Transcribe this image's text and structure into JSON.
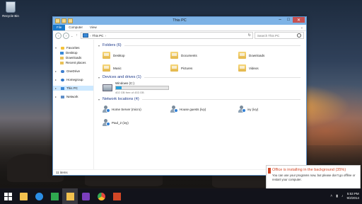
{
  "desktop": {
    "icons": [
      {
        "label": "Recycle Bin",
        "icon": "recycle-bin-icon"
      }
    ]
  },
  "window": {
    "title": "This PC",
    "ribbon_tabs": [
      "File",
      "Computer",
      "View"
    ],
    "address": {
      "path": [
        "This PC"
      ]
    },
    "search": {
      "placeholder": "Search This PC"
    },
    "nav_pane": [
      {
        "label": "Favorites",
        "icon": "star-icon",
        "level": 0,
        "expanded": true
      },
      {
        "label": "Desktop",
        "icon": "desktop-folder-icon",
        "level": 1
      },
      {
        "label": "Downloads",
        "icon": "downloads-folder-icon",
        "level": 1
      },
      {
        "label": "Recent places",
        "icon": "recent-places-icon",
        "level": 1
      },
      {
        "label": "OneDrive",
        "icon": "onedrive-icon",
        "level": 0
      },
      {
        "label": "Homegroup",
        "icon": "homegroup-icon",
        "level": 0
      },
      {
        "label": "This PC",
        "icon": "this-pc-icon",
        "level": 0,
        "selected": true
      },
      {
        "label": "Network",
        "icon": "network-icon",
        "level": 0
      }
    ],
    "sections": {
      "folders": {
        "title": "Folders (6)",
        "items": [
          "Desktop",
          "Documents",
          "Downloads",
          "Music",
          "Pictures",
          "Videos"
        ]
      },
      "drives": {
        "title": "Devices and drives (1)",
        "items": [
          {
            "label": "Windows (C:)",
            "free_text": "402 GB free of 453 GB",
            "used_fraction": 0.11
          }
        ]
      },
      "network": {
        "title": "Network locations (4)",
        "items": [
          "Home Server (micro)",
          "House guests (ivy)",
          "ivy (ivy)",
          "Paul_2 (ivy)"
        ]
      }
    },
    "status": {
      "item_count": "11 items"
    }
  },
  "toast": {
    "title": "Office is installing in the background (35%)",
    "message": "You can use your programs now, but please don't go offline or restart your computer.",
    "progress_percent": 35,
    "accent": "#d24726"
  },
  "taskbar": {
    "apps": [
      {
        "name": "start-button",
        "color": "#ffffff"
      },
      {
        "name": "file-explorer",
        "color": "#f2c14e"
      },
      {
        "name": "internet-explorer",
        "color": "#2b8ee6"
      },
      {
        "name": "store",
        "color": "#2fa84f"
      },
      {
        "name": "file-explorer-active",
        "color": "#f2c14e"
      },
      {
        "name": "settings",
        "color": "#7b3fbd"
      },
      {
        "name": "chrome",
        "color": "#e8453c"
      },
      {
        "name": "office",
        "color": "#d24726"
      }
    ],
    "clock": {
      "time": "5:53 PM",
      "date": "9/2/2014"
    }
  }
}
